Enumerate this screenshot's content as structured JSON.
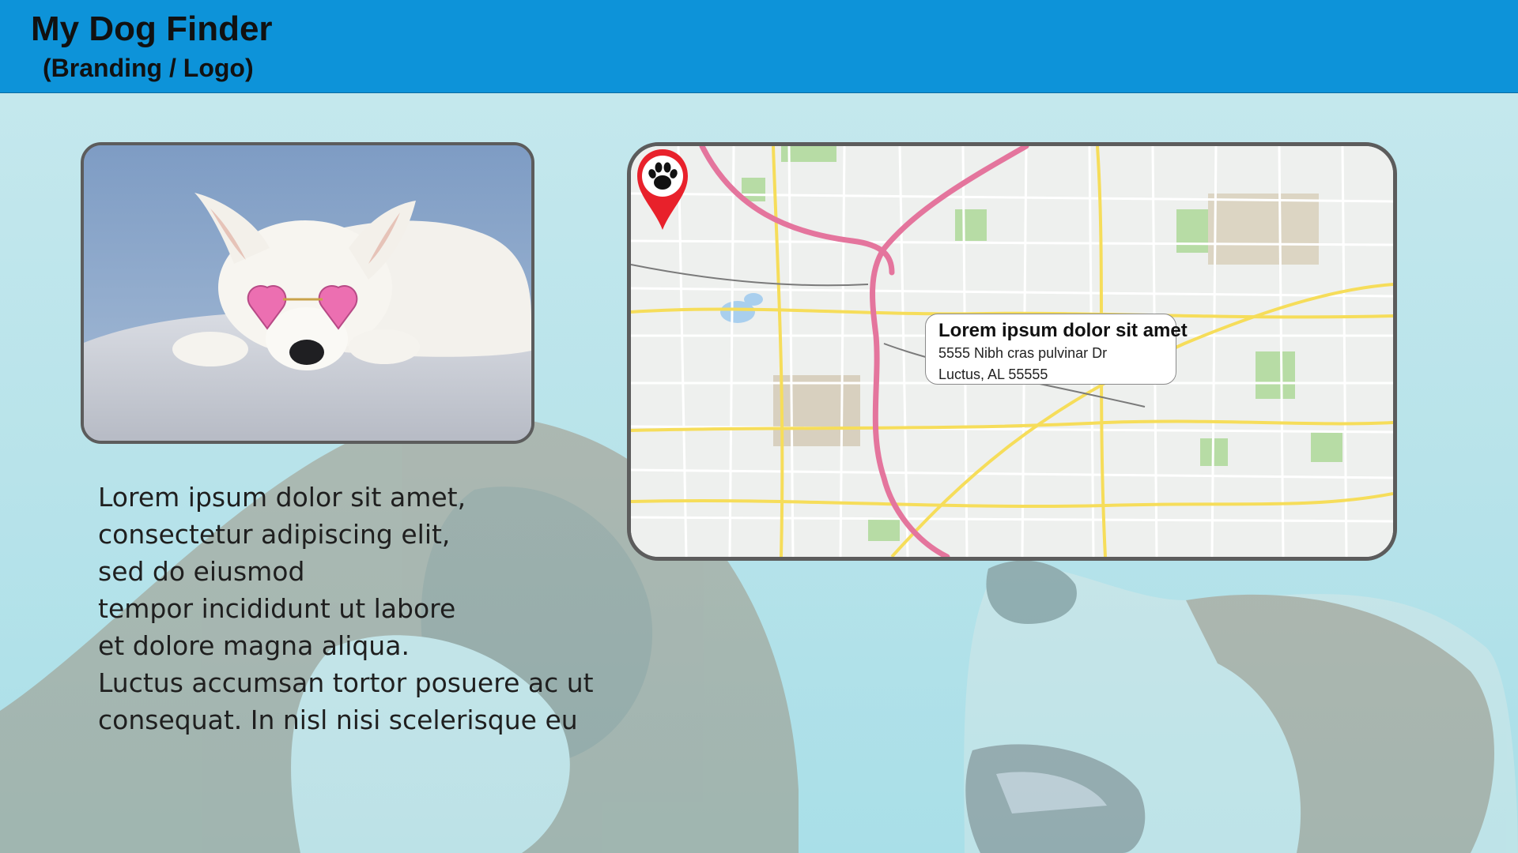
{
  "header": {
    "title": "My Dog Finder",
    "subtitle": "(Branding / Logo)",
    "background_color": "#0d93d9"
  },
  "photo": {
    "icon": "dog-with-heart-sunglasses"
  },
  "map": {
    "pin_icon": "paw-print-icon",
    "pin_color": "#e8212b",
    "popup": {
      "title": "Lorem ipsum dolor sit amet",
      "address_line1": "5555 Nibh cras pulvinar Dr",
      "address_line2": "Luctus, AL 55555"
    }
  },
  "body": {
    "lines": [
      "Lorem ipsum dolor sit amet,",
      "consectetur adipiscing elit,",
      "sed do eiusmod",
      "tempor incididunt ut labore",
      "et dolore magna aliqua.",
      "Luctus accumsan tortor posuere ac ut",
      "consequat. In nisl nisi scelerisque eu"
    ]
  }
}
